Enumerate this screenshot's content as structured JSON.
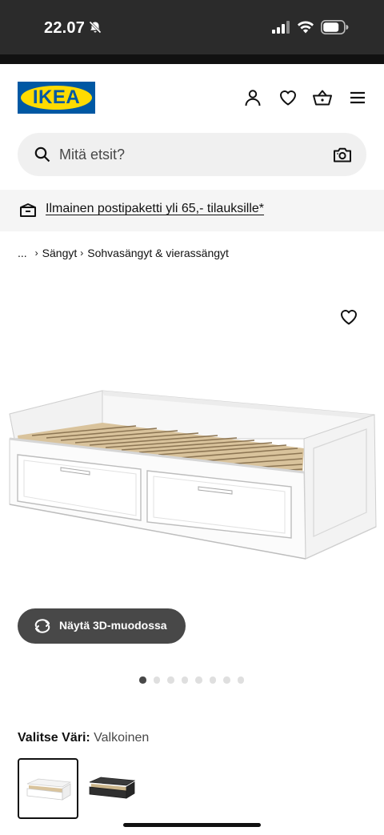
{
  "status_bar": {
    "time": "22.07",
    "icons": [
      "bell-off-icon",
      "signal-icon",
      "wifi-icon",
      "battery-icon"
    ]
  },
  "header": {
    "logo_text": "IKEA",
    "icons": [
      "user-icon",
      "heart-icon",
      "basket-icon",
      "menu-icon"
    ]
  },
  "search": {
    "placeholder": "Mitä etsit?"
  },
  "promo": {
    "text": "Ilmainen postipaketti yli 65,- tilauksille*"
  },
  "breadcrumb": {
    "ellipsis": "...",
    "items": [
      "Sängyt",
      "Sohvasängyt & vierassängyt"
    ]
  },
  "product": {
    "view_3d_label": "Näytä 3D-muodossa",
    "image_count": 8,
    "active_image": 1
  },
  "color_select": {
    "label": "Valitse Väri:",
    "selected_value": "Valkoinen",
    "options": [
      "Valkoinen",
      "Musta"
    ]
  },
  "colors": {
    "ikea_blue": "#0058a3",
    "ikea_yellow": "#ffdb00",
    "dark_button": "#484848",
    "promo_bg": "#f5f5f5",
    "search_bg": "#f0f0f0"
  }
}
